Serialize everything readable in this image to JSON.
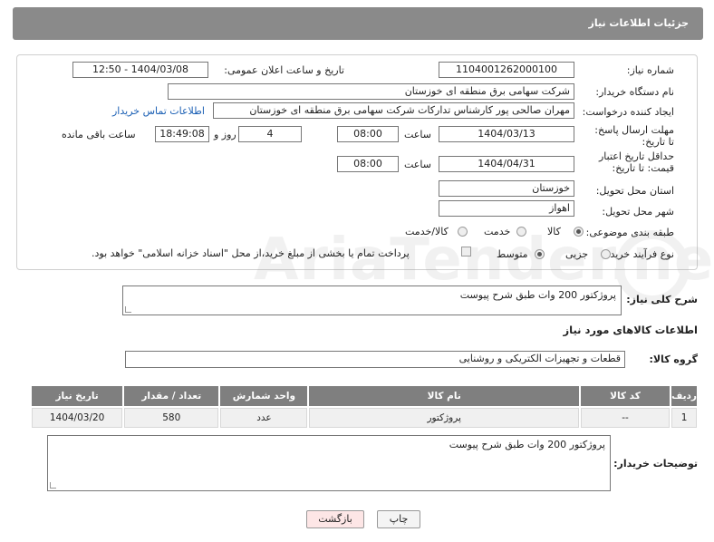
{
  "header": {
    "title": "جزئیات اطلاعات نیاز"
  },
  "form": {
    "need_number_label": "شماره نیاز:",
    "need_number": "1104001262000100",
    "announce_label": "تاریخ و ساعت اعلان عمومی:",
    "announce_value": "1404/03/08 - 12:50",
    "buyer_org_label": "نام دستگاه خریدار:",
    "buyer_org": "شرکت سهامی برق منطقه ای خوزستان",
    "creator_label": "ایجاد کننده درخواست:",
    "creator": "مهران صالحی پور کارشناس تدارکات شرکت سهامی برق منطقه ای خوزستان",
    "contact_link": "اطلاعات تماس خریدار",
    "reply_deadline_label": "مهلت ارسال پاسخ: تا تاریخ:",
    "reply_date": "1404/03/13",
    "time_label": "ساعت",
    "reply_time": "08:00",
    "days_value": "4",
    "days_label": "روز و",
    "remaining_time": "18:49:08",
    "remaining_label": "ساعت باقی مانده",
    "price_deadline_label": "حداقل تاریخ اعتبار قیمت: تا تاریخ:",
    "price_date": "1404/04/31",
    "price_time": "08:00",
    "province_label": "استان محل تحویل:",
    "province": "خوزستان",
    "city_label": "شهر محل تحویل:",
    "city": "اهواز",
    "category_label": "طبقه بندی موضوعی:",
    "category_options": [
      "کالا",
      "خدمت",
      "کالا/خدمت"
    ],
    "process_label": "نوع فرآیند خرید :",
    "process_options": [
      "جزیی",
      "متوسط"
    ],
    "payment_note": "پرداخت تمام یا بخشی از مبلغ خرید،از محل \"اسناد خزانه اسلامی\" خواهد بود."
  },
  "description": {
    "label": "شرح کلی نیاز:",
    "value": "پروژکتور 200 وات طبق شرح پیوست"
  },
  "goods": {
    "section_title": "اطلاعات کالاهای مورد نیاز",
    "group_label": "گروه کالا:",
    "group_value": "قطعات و تجهیزات الکتریکی و روشنایی",
    "columns": [
      "ردیف",
      "کد کالا",
      "نام کالا",
      "واحد شمارش",
      "تعداد / مقدار",
      "تاریخ نیاز"
    ],
    "rows": [
      {
        "row": "1",
        "code": "--",
        "name": "پروژکتور",
        "unit": "عدد",
        "qty": "580",
        "date": "1404/03/20"
      }
    ]
  },
  "buyer_notes": {
    "label": "توضیحات خریدار:",
    "value": "پروژکتور 200 وات طبق شرح پیوست"
  },
  "buttons": {
    "print": "چاپ",
    "back": "بازگشت"
  },
  "watermark": "AriaTender.neT",
  "colors": {
    "header_bg": "#8a8a8a",
    "table_header_bg": "#7f7f7f",
    "link": "#1a5fb4",
    "back_button_bg": "#fde6e6",
    "print_button_bg": "#f4f4f4"
  }
}
